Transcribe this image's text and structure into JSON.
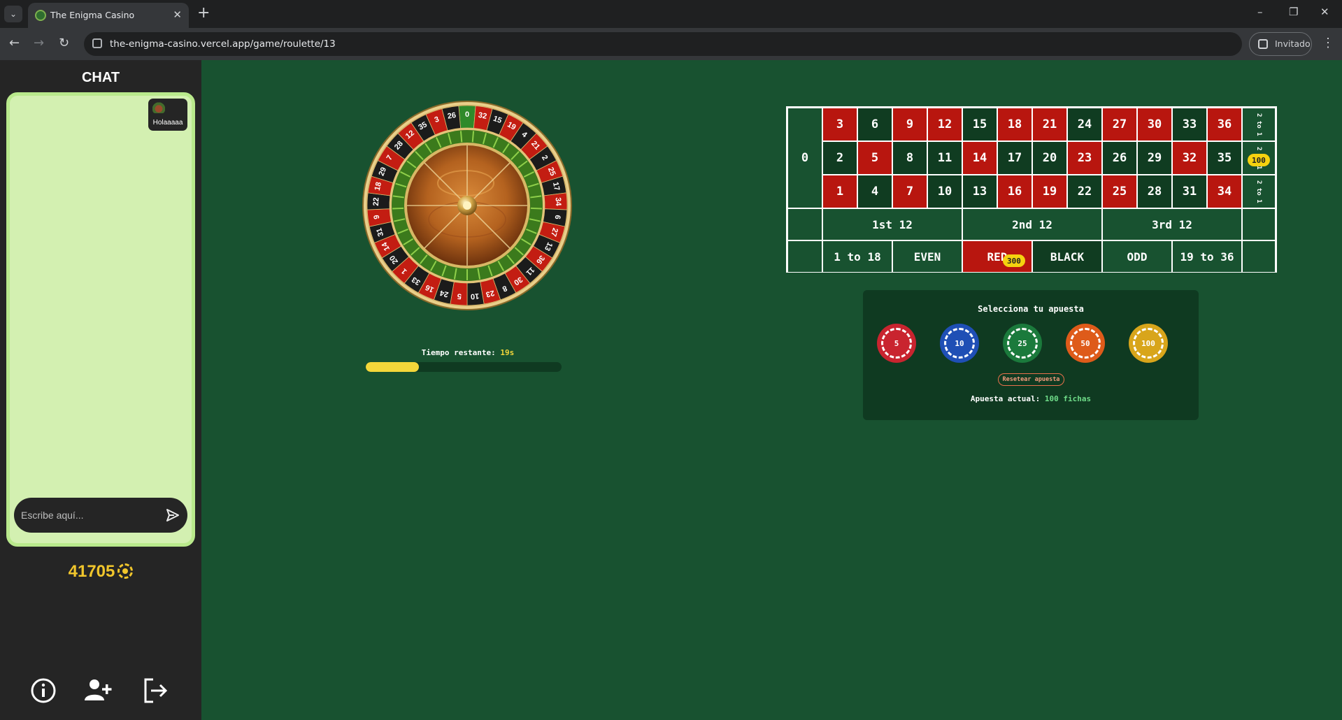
{
  "browser": {
    "tab_title": "The Enigma Casino",
    "url": "the-enigma-casino.vercel.app/game/roulette/13",
    "profile_label": "Invitado"
  },
  "sidebar": {
    "chat_title": "CHAT",
    "messages": [
      {
        "text": "Holaaaaa"
      }
    ],
    "input_placeholder": "Escribe aquí...",
    "balance": "41705",
    "icons": [
      "info-icon",
      "add-friend-icon",
      "logout-icon"
    ]
  },
  "timer": {
    "label": "Tiempo restante:",
    "seconds": "19s",
    "fraction": 0.27
  },
  "table": {
    "zero": "0",
    "rows": [
      [
        "3",
        "6",
        "9",
        "12",
        "15",
        "18",
        "21",
        "24",
        "27",
        "30",
        "33",
        "36"
      ],
      [
        "2",
        "5",
        "8",
        "11",
        "14",
        "17",
        "20",
        "23",
        "26",
        "29",
        "32",
        "35"
      ],
      [
        "1",
        "4",
        "7",
        "10",
        "13",
        "16",
        "19",
        "22",
        "25",
        "28",
        "31",
        "34"
      ]
    ],
    "red_numbers": [
      1,
      3,
      5,
      7,
      9,
      12,
      14,
      16,
      18,
      19,
      21,
      23,
      25,
      27,
      30,
      32,
      34,
      36
    ],
    "column_label": "2 to 1",
    "dozens": [
      "1st 12",
      "2nd 12",
      "3rd 12"
    ],
    "outside": [
      "1 to 18",
      "EVEN",
      "RED",
      "BLACK",
      "ODD",
      "19 to 36"
    ],
    "placed_bets": {
      "column_middle": "100",
      "red": "300"
    }
  },
  "bet_panel": {
    "title": "Selecciona tu apuesta",
    "chips": [
      {
        "value": "5",
        "color": "#c9242f"
      },
      {
        "value": "10",
        "color": "#1f4fb5"
      },
      {
        "value": "25",
        "color": "#1b7a3c"
      },
      {
        "value": "50",
        "color": "#de5b1a"
      },
      {
        "value": "100",
        "color": "#d8a51b"
      }
    ],
    "reset_label": "Resetear apuesta",
    "current_label": "Apuesta actual:",
    "current_amount": "100 fichas"
  },
  "wheel": {
    "sequence": [
      "0",
      "32",
      "15",
      "19",
      "4",
      "21",
      "2",
      "25",
      "17",
      "34",
      "6",
      "27",
      "13",
      "36",
      "11",
      "30",
      "8",
      "23",
      "10",
      "5",
      "24",
      "16",
      "33",
      "1",
      "20",
      "14",
      "31",
      "9",
      "22",
      "18",
      "29",
      "7",
      "28",
      "12",
      "35",
      "3",
      "26"
    ]
  }
}
